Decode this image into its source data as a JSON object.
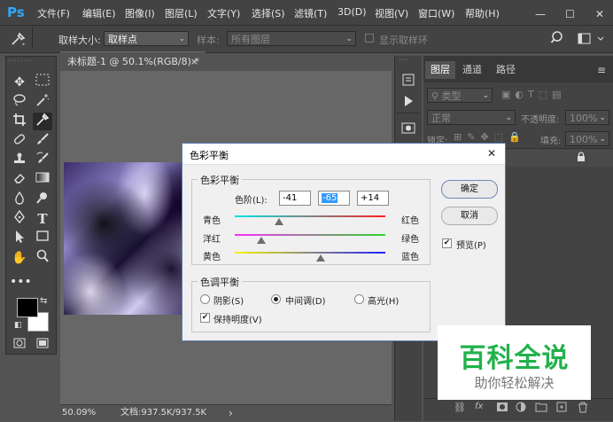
{
  "menubar": {
    "logo": "Ps",
    "items": [
      "文件(F)",
      "编辑(E)",
      "图像(I)",
      "图层(L)",
      "文字(Y)",
      "选择(S)",
      "滤镜(T)",
      "3D(D)",
      "视图(V)",
      "窗口(W)",
      "帮助(H)"
    ],
    "win_min": "—",
    "win_max": "☐",
    "win_close": "✕"
  },
  "options": {
    "sample_size_label": "取样大小:",
    "sample_size_value": "取样点",
    "sample_label": "样本:",
    "sample_value": "所有图层",
    "show_ring_label": "显示取样环"
  },
  "document": {
    "tab_title": "未标题-1 @ 50.1%(RGB/8) *",
    "tab_close": "×",
    "zoom": "50.09%",
    "doc_info": "文档:937.5K/937.5K",
    "status_arrow": "›"
  },
  "layers_panel": {
    "tabs": [
      "图层",
      "通道",
      "路径"
    ],
    "filter_label": "类型",
    "blend_mode": "正常",
    "opacity_label": "不透明度:",
    "opacity_value": "100%",
    "lock_label": "锁定:",
    "fill_label": "填充:",
    "fill_value": "100%",
    "bottom_icons": [
      "link-icon",
      "fx-icon",
      "mask-icon",
      "adjustment-icon",
      "group-icon",
      "new-layer-icon",
      "trash-icon"
    ]
  },
  "dialog": {
    "title": "色彩平衡",
    "close": "✕",
    "color_balance_group": "色彩平衡",
    "levels_label": "色阶(L):",
    "levels": [
      "-41",
      "-65",
      "+14"
    ],
    "sliders": [
      {
        "left": "青色",
        "right": "红色",
        "value": -41
      },
      {
        "left": "洋红",
        "right": "绿色",
        "value": -65
      },
      {
        "left": "黄色",
        "right": "蓝色",
        "value": 14
      }
    ],
    "tone_group": "色调平衡",
    "tones": [
      "阴影(S)",
      "中间调(D)",
      "高光(H)"
    ],
    "selected_tone": 1,
    "preserve_label": "保持明度(V)",
    "ok": "确定",
    "cancel": "取消",
    "preview": "预览(P)",
    "check_mark": "✔"
  },
  "watermark": {
    "title": "百科全说",
    "subtitle": "助你轻松解决"
  }
}
